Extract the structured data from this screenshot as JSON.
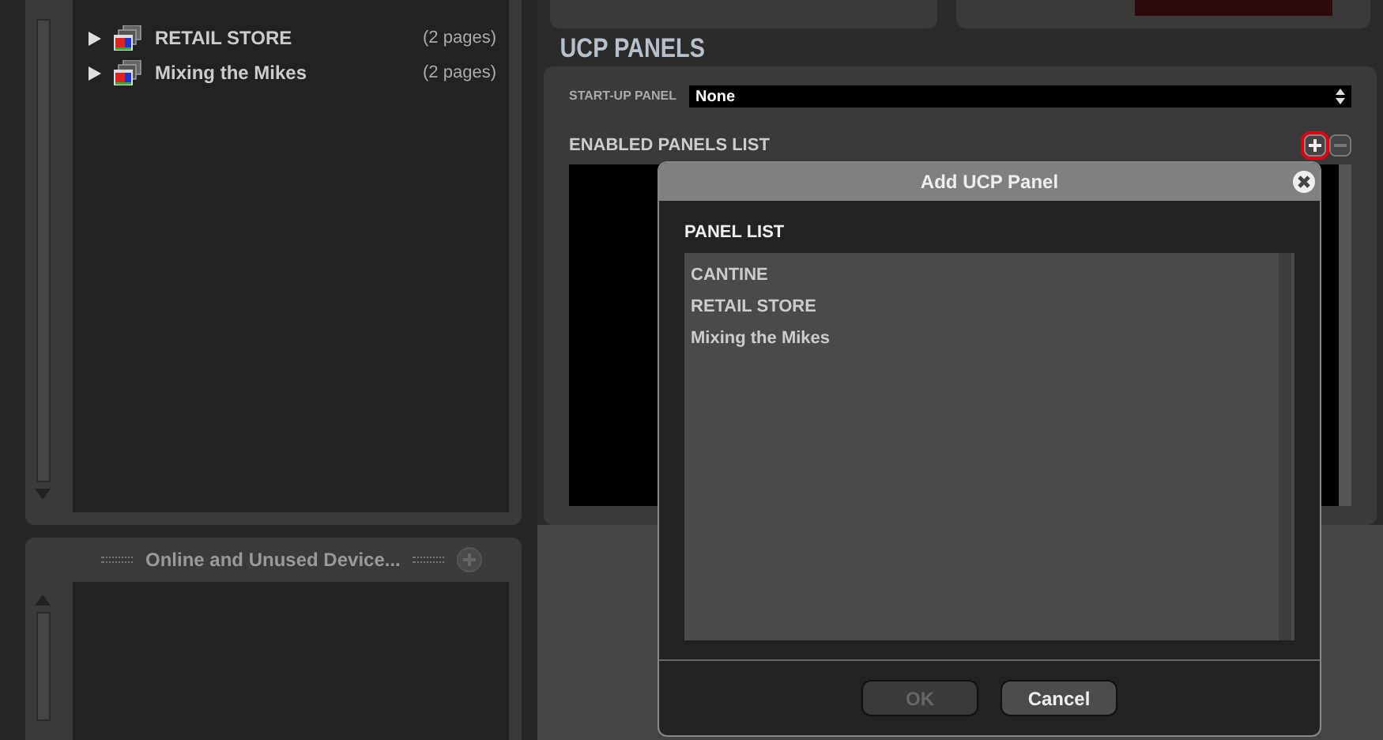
{
  "tree": {
    "items": [
      {
        "name": "RETAIL STORE",
        "pages": "(2 pages)",
        "expanded": false
      },
      {
        "name": "Mixing the Mikes",
        "pages": "(2 pages)",
        "expanded": false
      }
    ]
  },
  "devices_panel": {
    "title": "Online and Unused Device..."
  },
  "ucp_panels": {
    "title": "UCP PANELS",
    "startup_label": "START-UP PANEL",
    "startup_value": "None",
    "enabled_label": "ENABLED PANELS LIST"
  },
  "dialog": {
    "title": "Add UCP Panel",
    "list_label": "PANEL LIST",
    "items": [
      {
        "name": "CANTINE",
        "selected": false
      },
      {
        "name": "RETAIL STORE",
        "selected": false
      },
      {
        "name": "Mixing the Mikes",
        "selected": false
      }
    ],
    "buttons": [
      {
        "label": "OK",
        "disabled": true
      },
      {
        "label": "Cancel",
        "disabled": false
      }
    ]
  }
}
